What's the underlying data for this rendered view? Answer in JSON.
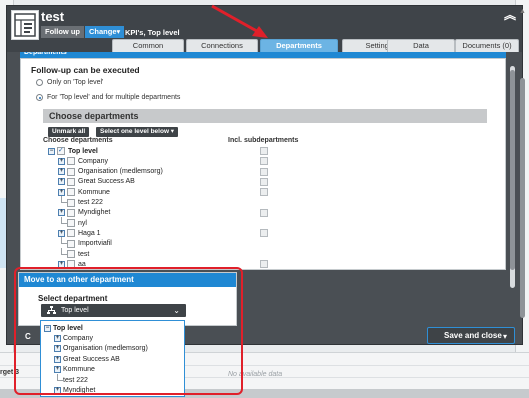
{
  "window": {
    "title": "test",
    "followup_label": "Follow up",
    "change_label": "Change",
    "kpi_text": "KPI's, Top level"
  },
  "tabs": [
    {
      "label": "Common"
    },
    {
      "label": "Connections"
    },
    {
      "label": "Departments"
    },
    {
      "label": "Settings"
    },
    {
      "label": "Data"
    },
    {
      "label": "Documents (0)"
    }
  ],
  "departments_panel": {
    "strip_title": "Departments",
    "heading": "Follow-up can be executed",
    "radio_top_only": "Only on 'Top level'",
    "radio_multiple": "For 'Top level' and for multiple departments",
    "section_title": "Choose departments",
    "unmark_all": "Unmark all",
    "select_level_below": "Select one level below",
    "col_choose": "Choose departments",
    "col_incl": "Incl. subdepartments",
    "tree": [
      {
        "label": "Top level",
        "type": "root",
        "checked": true,
        "sub": true
      },
      {
        "label": "Company",
        "type": "node",
        "checked": false,
        "sub": true
      },
      {
        "label": "Organisation (medlemsorg)",
        "type": "node",
        "checked": false,
        "sub": true
      },
      {
        "label": "Great Success AB",
        "type": "node",
        "checked": false,
        "sub": true
      },
      {
        "label": "Kommune",
        "type": "node",
        "checked": false,
        "sub": true
      },
      {
        "label": "test 222",
        "type": "leaf",
        "checked": false,
        "sub": false
      },
      {
        "label": "Myndighet",
        "type": "node",
        "checked": false,
        "sub": true
      },
      {
        "label": "nyl",
        "type": "leaf",
        "checked": false,
        "sub": false
      },
      {
        "label": "Haga 1",
        "type": "node",
        "checked": false,
        "sub": true
      },
      {
        "label": "Importviafil",
        "type": "leaf",
        "checked": false,
        "sub": false
      },
      {
        "label": "test",
        "type": "leaf",
        "checked": false,
        "sub": false
      },
      {
        "label": "aa",
        "type": "node",
        "checked": false,
        "sub": true
      }
    ]
  },
  "move_panel": {
    "title": "Move to an other department",
    "select_label": "Select department",
    "selected_value": "Top level"
  },
  "dropdown": [
    {
      "label": "Top level",
      "type": "root"
    },
    {
      "label": "Company",
      "type": "node"
    },
    {
      "label": "Organisation (medlemsorg)",
      "type": "node"
    },
    {
      "label": "Great Success AB",
      "type": "node"
    },
    {
      "label": "Kommune",
      "type": "node"
    },
    {
      "label": "test 222",
      "type": "leaf"
    },
    {
      "label": "Myndighet",
      "type": "node"
    }
  ],
  "footer": {
    "save_close": "Save and close",
    "cancel_partial": "C"
  },
  "background": {
    "no_data": "No available data",
    "row_label": "rget 3"
  },
  "colors": {
    "accent": "#1f88d3",
    "active_tab": "#6cb4e4",
    "annotation": "#e0202a"
  }
}
